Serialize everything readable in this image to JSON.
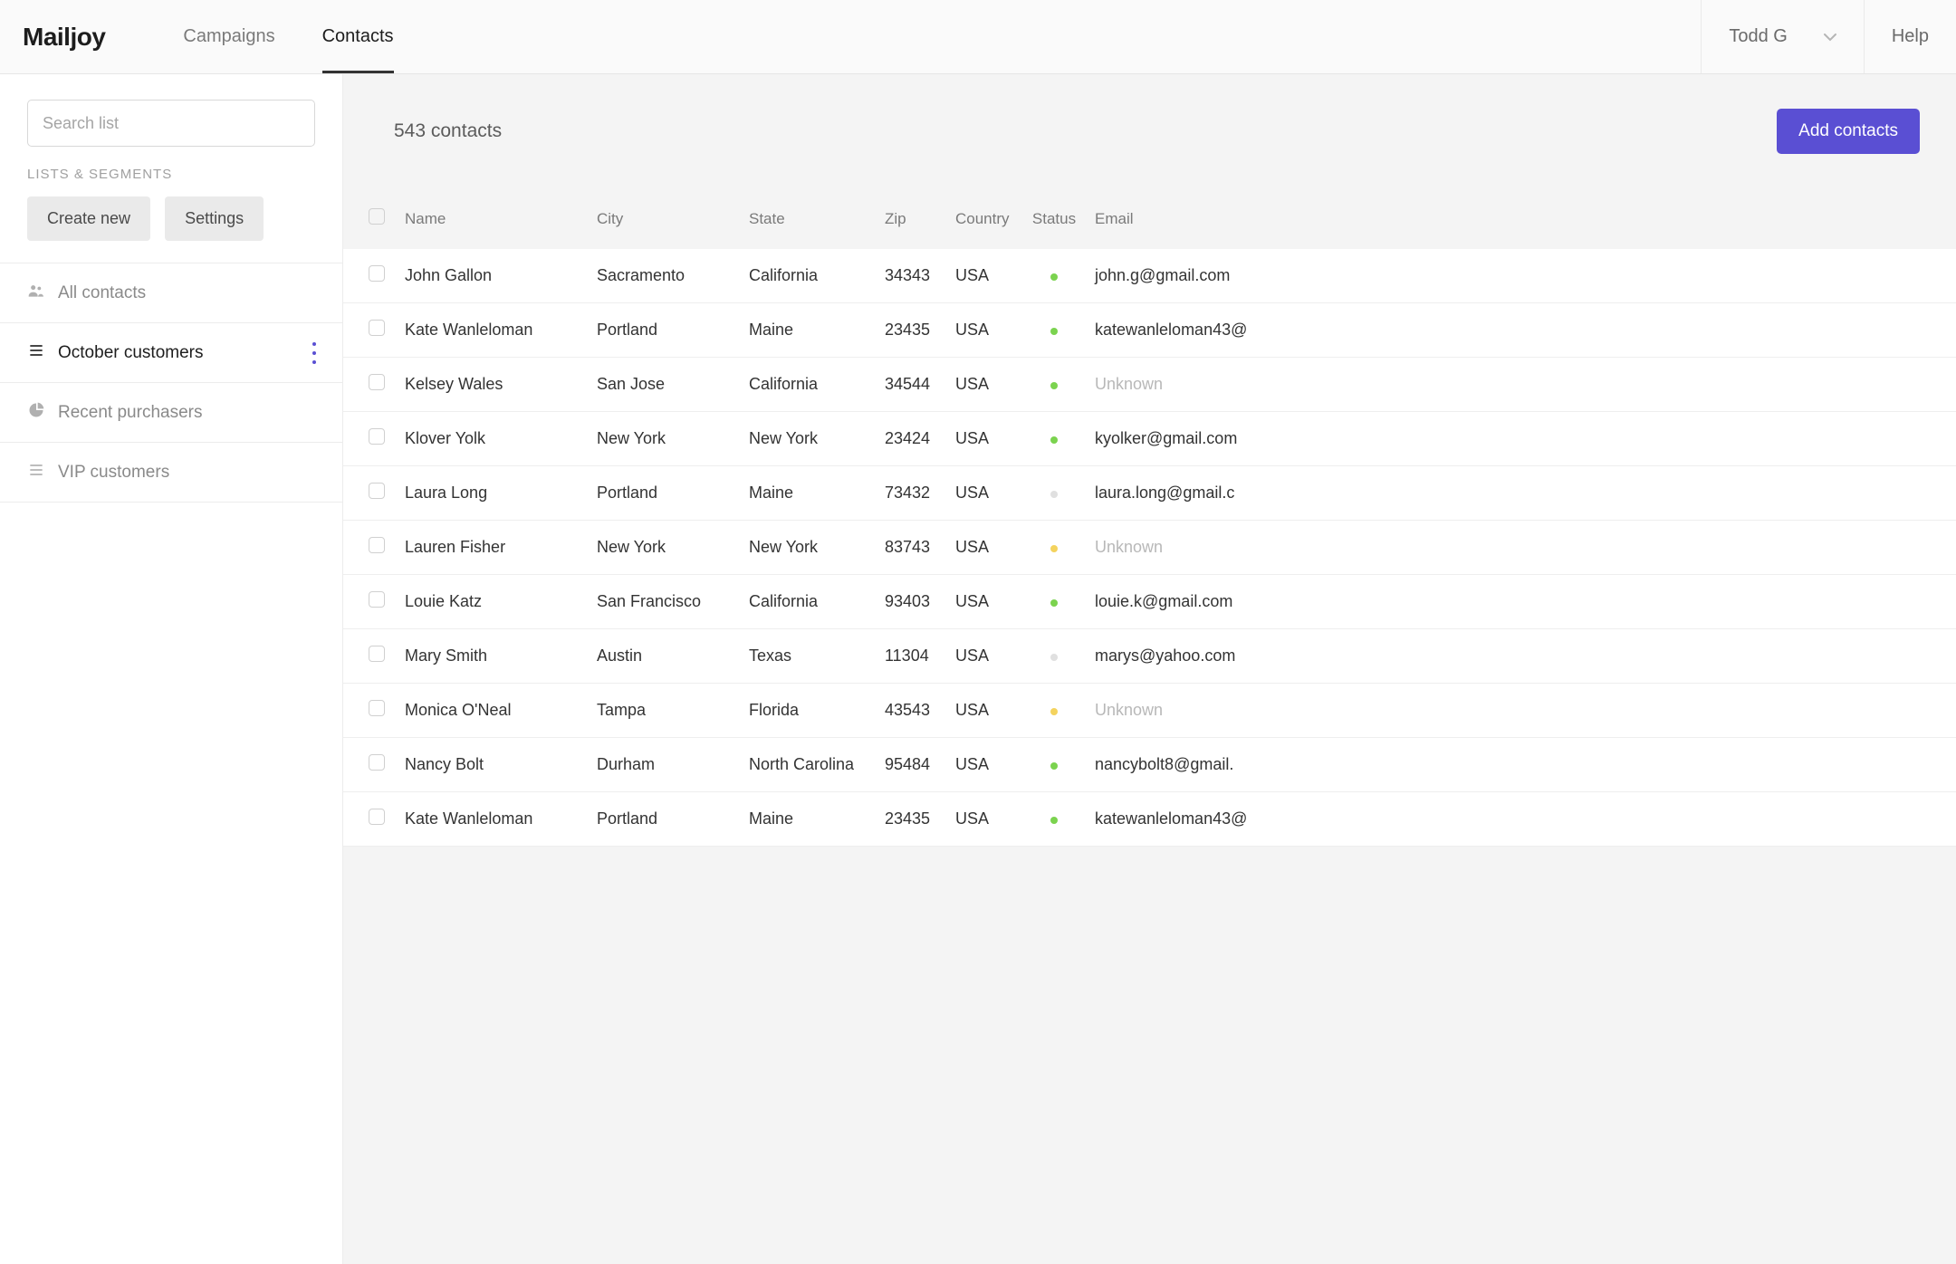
{
  "header": {
    "logo": "Mailjoy",
    "nav": {
      "campaigns": "Campaigns",
      "contacts": "Contacts"
    },
    "user_name": "Todd G",
    "help": "Help"
  },
  "sidebar": {
    "search_placeholder": "Search list",
    "section_title": "LISTS & SEGMENTS",
    "create_new": "Create new",
    "settings": "Settings",
    "items": [
      {
        "id": "all-contacts",
        "label": "All contacts",
        "icon": "people",
        "active": false
      },
      {
        "id": "october-customers",
        "label": "October customers",
        "icon": "list",
        "active": true
      },
      {
        "id": "recent-purchasers",
        "label": "Recent purchasers",
        "icon": "pie",
        "active": false
      },
      {
        "id": "vip-customers",
        "label": "VIP customers",
        "icon": "list",
        "active": false
      }
    ]
  },
  "main": {
    "count_text": "543 contacts",
    "add_button": "Add contacts",
    "columns": {
      "name": "Name",
      "city": "City",
      "state": "State",
      "zip": "Zip",
      "country": "Country",
      "status": "Status",
      "email": "Email"
    },
    "rows": [
      {
        "name": "John Gallon",
        "city": "Sacramento",
        "state": "California",
        "zip": "34343",
        "country": "USA",
        "status": "green",
        "email": "john.g@gmail.com"
      },
      {
        "name": "Kate Wanleloman",
        "city": "Portland",
        "state": "Maine",
        "zip": "23435",
        "country": "USA",
        "status": "green",
        "email": "katewanleloman43@"
      },
      {
        "name": "Kelsey Wales",
        "city": "San Jose",
        "state": "California",
        "zip": "34544",
        "country": "USA",
        "status": "green",
        "email": "Unknown",
        "unknown": true
      },
      {
        "name": "Klover Yolk",
        "city": "New York",
        "state": "New York",
        "zip": "23424",
        "country": "USA",
        "status": "green",
        "email": "kyolker@gmail.com"
      },
      {
        "name": "Laura Long",
        "city": "Portland",
        "state": "Maine",
        "zip": "73432",
        "country": "USA",
        "status": "grey",
        "email": "laura.long@gmail.c"
      },
      {
        "name": "Lauren Fisher",
        "city": "New York",
        "state": "New York",
        "zip": "83743",
        "country": "USA",
        "status": "yellow",
        "email": "Unknown",
        "unknown": true
      },
      {
        "name": "Louie Katz",
        "city": "San Francisco",
        "state": "California",
        "zip": "93403",
        "country": "USA",
        "status": "green",
        "email": "louie.k@gmail.com"
      },
      {
        "name": "Mary Smith",
        "city": "Austin",
        "state": "Texas",
        "zip": "11304",
        "country": "USA",
        "status": "grey",
        "email": "marys@yahoo.com"
      },
      {
        "name": "Monica O'Neal",
        "city": "Tampa",
        "state": "Florida",
        "zip": "43543",
        "country": "USA",
        "status": "yellow",
        "email": "Unknown",
        "unknown": true
      },
      {
        "name": "Nancy Bolt",
        "city": "Durham",
        "state": "North Carolina",
        "zip": "95484",
        "country": "USA",
        "status": "green",
        "email": "nancybolt8@gmail."
      },
      {
        "name": "Kate Wanleloman",
        "city": "Portland",
        "state": "Maine",
        "zip": "23435",
        "country": "USA",
        "status": "green",
        "email": "katewanleloman43@"
      }
    ]
  }
}
